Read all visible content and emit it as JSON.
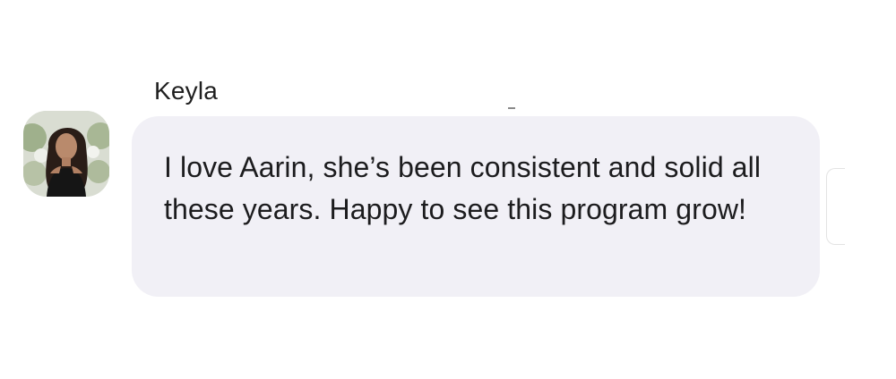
{
  "message": {
    "sender_name": "Keyla",
    "text": "I love Aarin, she’s been consistent and solid all these years. Happy to see this program grow!",
    "avatar_icon": "person-avatar-icon"
  },
  "colors": {
    "bubble_background": "#f1f0f6",
    "text": "#1c1c1e",
    "page_background": "#ffffff"
  }
}
